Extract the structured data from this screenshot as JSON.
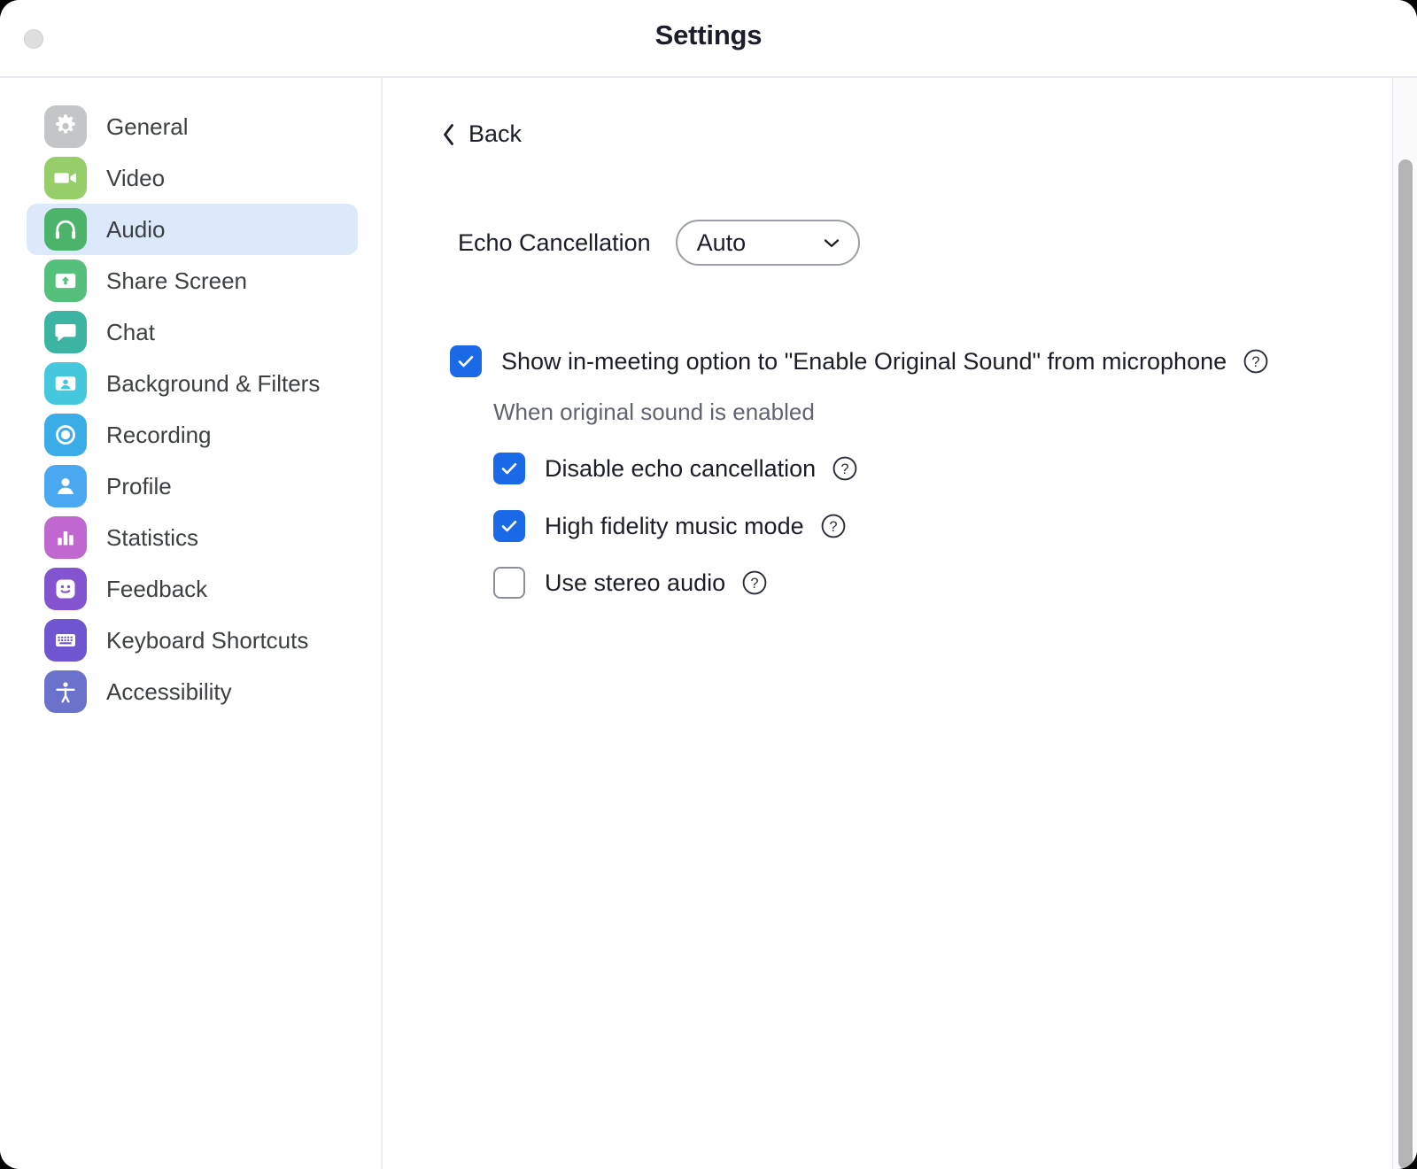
{
  "window": {
    "title": "Settings",
    "close_button": "close-dot"
  },
  "sidebar": {
    "items": [
      {
        "label": "General",
        "icon": "gear-icon",
        "color": "#c3c5c7",
        "active": false
      },
      {
        "label": "Video",
        "icon": "video-camera-icon",
        "color": "#96ce6a",
        "active": false
      },
      {
        "label": "Audio",
        "icon": "headphones-icon",
        "color": "#4cb36a",
        "active": true
      },
      {
        "label": "Share Screen",
        "icon": "share-screen-icon",
        "color": "#55c07b",
        "active": false
      },
      {
        "label": "Chat",
        "icon": "chat-bubble-icon",
        "color": "#3bb4a3",
        "active": false
      },
      {
        "label": "Background & Filters",
        "icon": "person-frame-icon",
        "color": "#45c8dd",
        "active": false
      },
      {
        "label": "Recording",
        "icon": "record-circle-icon",
        "color": "#3aade8",
        "active": false
      },
      {
        "label": "Profile",
        "icon": "person-icon",
        "color": "#4aa8f0",
        "active": false
      },
      {
        "label": "Statistics",
        "icon": "bar-chart-icon",
        "color": "#c068cf",
        "active": false
      },
      {
        "label": "Feedback",
        "icon": "smiley-face-icon",
        "color": "#8453cf",
        "active": false
      },
      {
        "label": "Keyboard Shortcuts",
        "icon": "keyboard-icon",
        "color": "#6f55cf",
        "active": false
      },
      {
        "label": "Accessibility",
        "icon": "accessibility-icon",
        "color": "#6a72cc",
        "active": false
      }
    ]
  },
  "main": {
    "back_label": "Back",
    "echo_cancellation": {
      "label": "Echo Cancellation",
      "value": "Auto",
      "options": [
        "Auto"
      ]
    },
    "show_original_sound": {
      "label": "Show in-meeting option to \"Enable Original Sound\" from microphone",
      "checked": true,
      "help": "?"
    },
    "subheading": "When original sound is enabled",
    "sub_options": [
      {
        "label": "Disable echo cancellation",
        "checked": true,
        "help": "?"
      },
      {
        "label": "High fidelity music mode",
        "checked": true,
        "help": "?"
      },
      {
        "label": "Use stereo audio",
        "checked": false,
        "help": "?"
      }
    ]
  },
  "colors": {
    "accent_checkbox": "#1a6ae8",
    "active_nav_bg": "#dce9fb",
    "title_text": "#1b1d29",
    "muted_text": "#5f6470",
    "scrollbar_thumb": "#b4b4b4"
  },
  "scrollbar": {
    "name": "vertical-scrollbar"
  }
}
